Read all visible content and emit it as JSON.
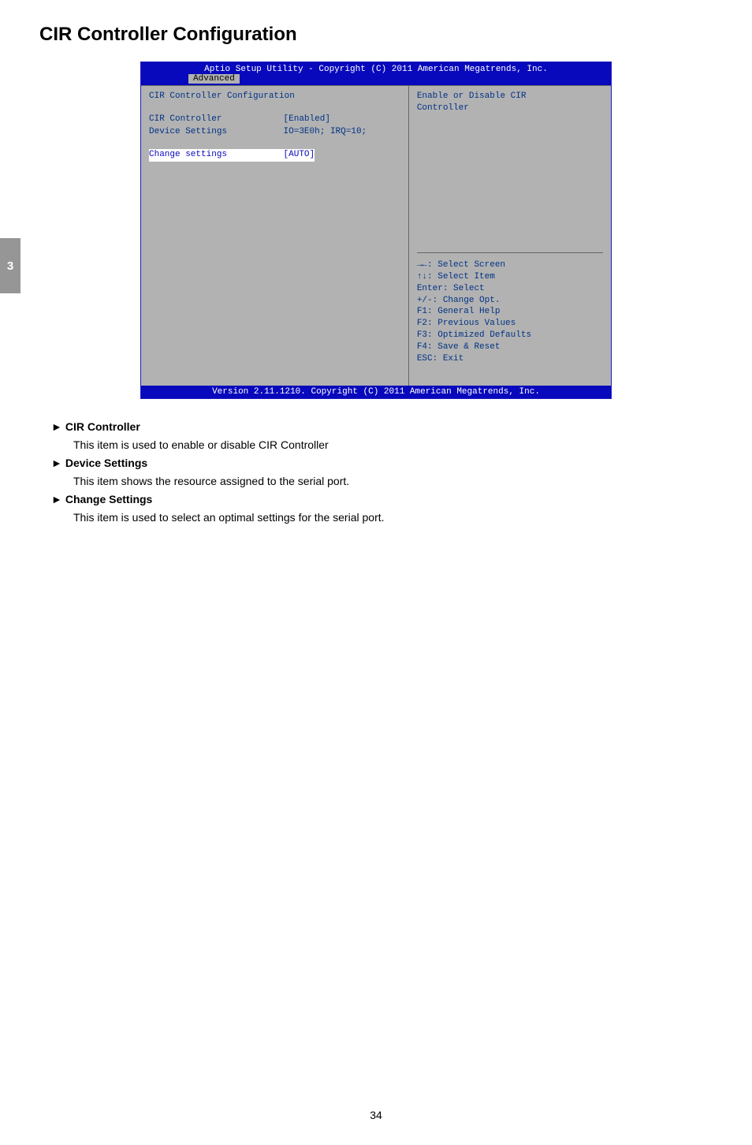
{
  "page": {
    "title": "CIR Controller Configuration",
    "number": "34",
    "side_tab": "3"
  },
  "bios": {
    "header": "Aptio Setup Utility - Copyright (C) 2011 American Megatrends, Inc.",
    "tab": "Advanced",
    "footer": "Version 2.11.1210. Copyright (C) 2011 American Megatrends, Inc.",
    "left_title": "CIR Controller Configuration",
    "rows": [
      {
        "label": "CIR Controller",
        "value": "[Enabled]",
        "highlight": false
      },
      {
        "label": "Device Settings",
        "value": "IO=3E0h; IRQ=10;",
        "highlight": false
      },
      {
        "label": "Change settings",
        "value": "[AUTO]",
        "highlight": true
      }
    ],
    "right_top": [
      "Enable or Disable CIR",
      "Controller"
    ],
    "help": [
      "→←: Select Screen",
      "↑↓: Select Item",
      "Enter: Select",
      "+/-: Change Opt.",
      "F1: General Help",
      "F2: Previous Values",
      "F3: Optimized Defaults",
      "F4: Save & Reset",
      "ESC: Exit"
    ]
  },
  "desc": {
    "items": [
      {
        "arrow": "►",
        "label": "CIR Controller",
        "text": "This item is used to enable or disable CIR Controller"
      },
      {
        "arrow": "►",
        "label": "Device Settings",
        "text": "This item shows the resource assigned to the serial port."
      },
      {
        "arrow": "►",
        "label": "Change Settings",
        "text": "This item is used to select an optimal settings for the serial port."
      }
    ]
  }
}
